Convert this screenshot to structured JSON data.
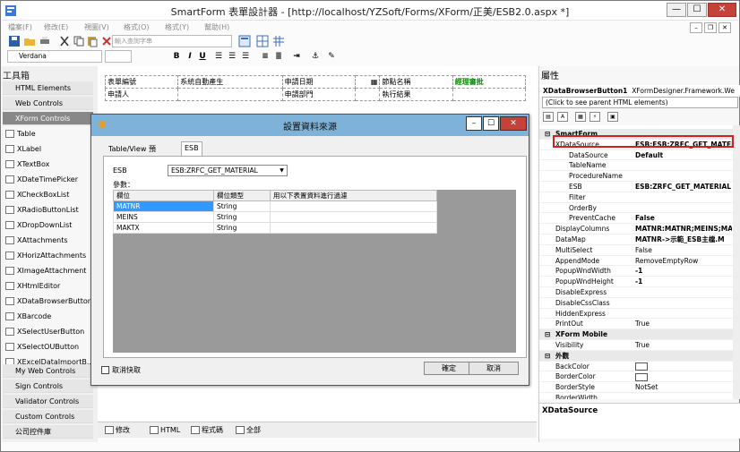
{
  "window": {
    "title": "SmartForm 表單設計器 - [http://localhost/YZSoft/Forms/XForm/正美/ESB2.0.aspx *]",
    "min_label": "—",
    "max_label": "☐",
    "close_label": "✕"
  },
  "menu": [
    "檔案(F)",
    "修改(E)",
    "視圖(V)",
    "格式(O)",
    "格式(Y)",
    "幫助(H)"
  ],
  "search": {
    "placeholder": "輸入查詢字串"
  },
  "font": {
    "family": "Verdana"
  },
  "toolbox": {
    "title": "工具箱",
    "groups_top": [
      "HTML Elements",
      "Web Controls",
      "XForm Controls"
    ],
    "items": [
      "Table",
      "XLabel",
      "XTextBox",
      "XDateTimePicker",
      "XCheckBoxList",
      "XRadioButtonList",
      "XDropDownList",
      "XAttachments",
      "XHorizAttachments",
      "XImageAttachment",
      "XHtmlEditor",
      "XDataBrowserButton",
      "XBarcode",
      "XSelectUserButton",
      "XSelectOUButton",
      "XExcelDataImportB..."
    ],
    "groups_bottom": [
      "My Web Controls",
      "Sign Controls",
      "Validator Controls",
      "Custom Controls",
      "公司控件庫"
    ]
  },
  "form": {
    "row1": [
      "表單編號",
      "系統自動產生",
      "申請日期",
      "",
      "節點名稱",
      "經理審批"
    ],
    "row2": [
      "申請人",
      "",
      "申請部門",
      "",
      "執行結果",
      ""
    ]
  },
  "design_tabs": [
    "修改",
    "HTML",
    "程式碼",
    "全部"
  ],
  "properties": {
    "title": "屬性",
    "object_name": "XDataBrowserButton1",
    "object_type": "XFormDesigner.Framework.We",
    "parent_hint": "(Click to see parent HTML elements)",
    "rows": [
      {
        "k": "SmartForm",
        "v": "",
        "cat": true,
        "indent": 1
      },
      {
        "k": "XDataSource",
        "v": "ESB:ESB:ZRFC_GET_MATER",
        "bold": true,
        "indent": 1
      },
      {
        "k": "DataSource",
        "v": "Default",
        "bold": true,
        "indent": 2
      },
      {
        "k": "TableName",
        "v": "",
        "indent": 2
      },
      {
        "k": "ProcedureName",
        "v": "",
        "indent": 2
      },
      {
        "k": "ESB",
        "v": "ESB:ZRFC_GET_MATERIAL",
        "bold": true,
        "indent": 2
      },
      {
        "k": "Filter",
        "v": "",
        "indent": 2
      },
      {
        "k": "OrderBy",
        "v": "",
        "indent": 2
      },
      {
        "k": "PreventCache",
        "v": "False",
        "bold": true,
        "indent": 2
      },
      {
        "k": "DisplayColumns",
        "v": "MATNR:MATNR;MEINS;MAI",
        "bold": true,
        "indent": 1
      },
      {
        "k": "DataMap",
        "v": "MATNR->示範_ESB主檔.M",
        "bold": true,
        "indent": 1
      },
      {
        "k": "MultiSelect",
        "v": "False",
        "indent": 1
      },
      {
        "k": "AppendMode",
        "v": "RemoveEmptyRow",
        "indent": 1
      },
      {
        "k": "PopupWndWidth",
        "v": "-1",
        "bold": true,
        "indent": 1
      },
      {
        "k": "PopupWndHeight",
        "v": "-1",
        "bold": true,
        "indent": 1
      },
      {
        "k": "DisableExpress",
        "v": "",
        "indent": 1
      },
      {
        "k": "DisableCssClass",
        "v": "",
        "indent": 1
      },
      {
        "k": "HiddenExpress",
        "v": "",
        "indent": 1
      },
      {
        "k": "PrintOut",
        "v": "True",
        "indent": 1
      },
      {
        "k": "XForm Mobile",
        "v": "",
        "cat": true,
        "indent": 1
      },
      {
        "k": "Visibility",
        "v": "True",
        "indent": 1
      },
      {
        "k": "外觀",
        "v": "",
        "cat": true,
        "indent": 1
      },
      {
        "k": "BackColor",
        "v": "",
        "swatch": true,
        "indent": 1
      },
      {
        "k": "BorderColor",
        "v": "",
        "swatch": true,
        "indent": 1
      },
      {
        "k": "BorderStyle",
        "v": "NotSet",
        "indent": 1
      },
      {
        "k": "BorderWidth",
        "v": "",
        "indent": 1
      }
    ],
    "description": "XDataSource"
  },
  "dialog": {
    "title": "設置資料來源",
    "tabs": [
      "Table/View",
      "預存程序",
      "ESB"
    ],
    "esb_label": "ESB",
    "esb_value": "ESB:ZRFC_GET_MATERIAL",
    "params_label": "參數：",
    "columns": [
      "欄位",
      "欄位類型",
      "用以下表置資料進行過濾"
    ],
    "rows": [
      [
        "MATNR",
        "String",
        ""
      ],
      [
        "MEINS",
        "String",
        ""
      ],
      [
        "MAKTX",
        "String",
        ""
      ]
    ],
    "nocache_label": "取消快取",
    "ok_label": "確定",
    "cancel_label": "取消"
  }
}
